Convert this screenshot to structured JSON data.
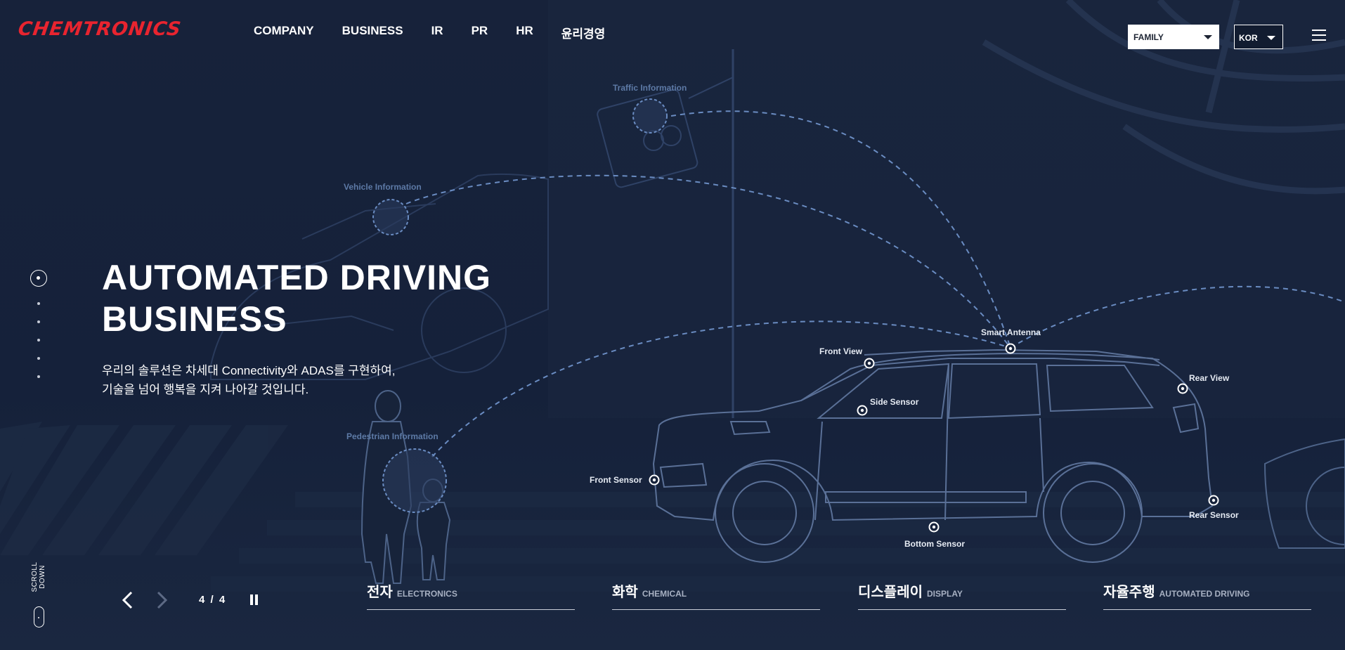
{
  "header": {
    "logo": "CHEMTRONICS",
    "nav": [
      "COMPANY",
      "BUSINESS",
      "IR",
      "PR",
      "HR",
      "윤리경영"
    ],
    "family_select": "FAMILY",
    "lang_select": "KOR"
  },
  "hero": {
    "title_line1": "AUTOMATED DRIVING",
    "title_line2": "BUSINESS",
    "desc_line1": "우리의 솔루션은 차세대 Connectivity와 ADAS를 구현하여,",
    "desc_line2": "기술을 넘어 행복을 지켜 나아갈 것입니다."
  },
  "diagram": {
    "traffic_information": "Traffic Information",
    "vehicle_information": "Vehicle Information",
    "pedestrian_information": "Pedestrian Information",
    "smart_antenna": "Smart Antenna",
    "front_view": "Front View",
    "rear_view": "Rear View",
    "side_sensor": "Side Sensor",
    "front_sensor": "Front Sensor",
    "rear_sensor": "Rear Sensor",
    "bottom_sensor": "Bottom Sensor"
  },
  "pager": {
    "slide_current": "4",
    "slide_sep": "/",
    "slide_total": "4",
    "scroll_down": "SCROLL DOWN"
  },
  "business_tabs": [
    {
      "ko": "전자",
      "en": "ELECTRONICS"
    },
    {
      "ko": "화학",
      "en": "CHEMICAL"
    },
    {
      "ko": "디스플레이",
      "en": "DISPLAY"
    },
    {
      "ko": "자율주행",
      "en": "AUTOMATED DRIVING"
    }
  ],
  "colors": {
    "background": "#16223a",
    "logo_red": "#e8242f",
    "line_blue": "#5d7aa6"
  }
}
